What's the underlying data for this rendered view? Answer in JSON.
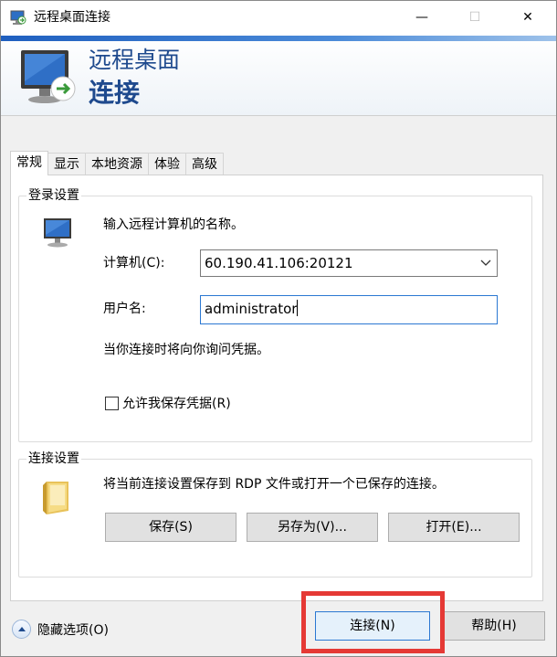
{
  "window": {
    "title": "远程桌面连接",
    "min_glyph": "—",
    "max_glyph": "☐",
    "close_glyph": "✕"
  },
  "banner": {
    "line1": "远程桌面",
    "line2": "连接"
  },
  "tabs": [
    "常规",
    "显示",
    "本地资源",
    "体验",
    "高级"
  ],
  "login": {
    "group_title": "登录设置",
    "instruction": "输入远程计算机的名称。",
    "computer_label": "计算机(C):",
    "computer_value": "60.190.41.106:20121",
    "user_label": "用户名:",
    "user_value": "administrator",
    "note": "当你连接时将向你询问凭据。",
    "save_creds_label": "允许我保存凭据(R)"
  },
  "connection": {
    "group_title": "连接设置",
    "description": "将当前连接设置保存到 RDP 文件或打开一个已保存的连接。",
    "save_button": "保存(S)",
    "save_as_button": "另存为(V)...",
    "open_button": "打开(E)..."
  },
  "footer": {
    "hide_options": "隐藏选项(O)",
    "connect_button": "连接(N)",
    "help_button": "帮助(H)"
  },
  "colors": {
    "accent": "#1f4a8e",
    "highlight": "#e53935",
    "focus": "#2b78d2"
  },
  "icons": [
    "remote-desktop-icon",
    "computer-icon",
    "folder-icon",
    "collapse-arrow-icon",
    "dropdown-chevron-icon"
  ]
}
